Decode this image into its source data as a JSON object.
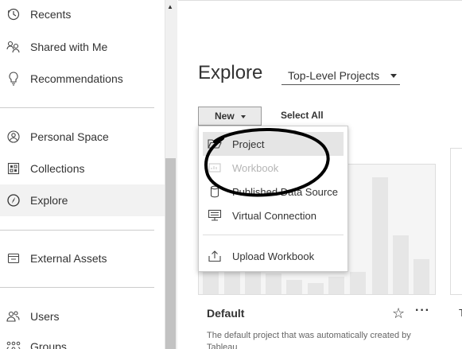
{
  "sidebar": {
    "items": [
      {
        "label": "Recents",
        "icon": "clock-icon"
      },
      {
        "label": "Shared with Me",
        "icon": "shared-users-icon"
      },
      {
        "label": "Recommendations",
        "icon": "lightbulb-icon"
      },
      {
        "label": "Personal Space",
        "icon": "person-circle-icon"
      },
      {
        "label": "Collections",
        "icon": "collections-icon"
      },
      {
        "label": "Explore",
        "icon": "compass-icon"
      },
      {
        "label": "External Assets",
        "icon": "external-assets-icon"
      },
      {
        "label": "Users",
        "icon": "users-icon"
      },
      {
        "label": "Groups",
        "icon": "groups-icon"
      }
    ],
    "active": "Explore"
  },
  "main": {
    "title": "Explore",
    "project_filter": "Top-Level Projects",
    "new_button": "New",
    "select_all": "Select All"
  },
  "menu": {
    "items": [
      {
        "label": "Project",
        "icon": "folder-open-icon",
        "highlighted": true,
        "disabled": false
      },
      {
        "label": "Workbook",
        "icon": "workbook-icon",
        "highlighted": false,
        "disabled": true
      },
      {
        "label": "Published Data Source",
        "icon": "database-icon",
        "highlighted": false,
        "disabled": false
      },
      {
        "label": "Virtual Connection",
        "icon": "virtual-connection-icon",
        "highlighted": false,
        "disabled": false
      },
      {
        "label": "Upload Workbook",
        "icon": "upload-icon",
        "highlighted": false,
        "disabled": false
      }
    ]
  },
  "card": {
    "name": "Default",
    "description": "The default project that was automatically created by Tableau",
    "next_card_initial": "T"
  },
  "colors": {
    "active_bg": "#f2f2f2",
    "annotation": "#000000",
    "disabled_text": "#b5b5b5"
  }
}
